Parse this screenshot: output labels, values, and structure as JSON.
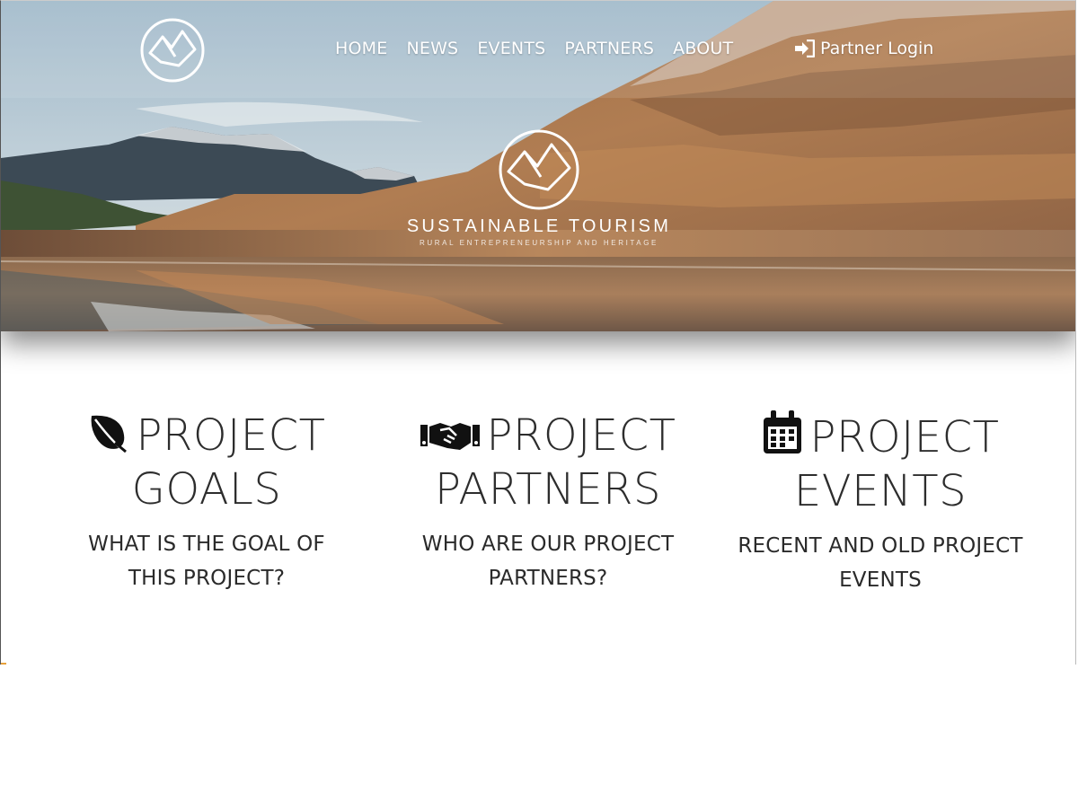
{
  "nav": {
    "logo_icon": "mountain-circle-logo",
    "links": [
      "HOME",
      "NEWS",
      "EVENTS",
      "PARTNERS",
      "ABOUT"
    ],
    "login_label": "Partner Login",
    "login_icon": "sign-in-icon"
  },
  "hero": {
    "logo_icon": "mountain-circle-logo",
    "title": "SUSTAINABLE TOURISM",
    "subtitle": "RURAL ENTREPRENEURSHIP AND HERITAGE"
  },
  "features": [
    {
      "icon": "leaf-icon",
      "heading_line1": "PROJECT",
      "heading_line2": "GOALS",
      "sub_line1": "WHAT IS THE GOAL OF",
      "sub_line2": "THIS PROJECT?"
    },
    {
      "icon": "handshake-icon",
      "heading_line1": "PROJECT",
      "heading_line2": "PARTNERS",
      "sub_line1": "WHO ARE OUR PROJECT",
      "sub_line2": "PARTNERS?"
    },
    {
      "icon": "calendar-icon",
      "heading_line1": "PROJECT",
      "heading_line2": "EVENTS",
      "sub_line1": "RECENT AND OLD PROJECT",
      "sub_line2": "EVENTS"
    }
  ],
  "colors": {
    "text_dark": "#1c1c1c",
    "nav_text": "#ffffff",
    "accent_edge": "#e8a13a"
  }
}
